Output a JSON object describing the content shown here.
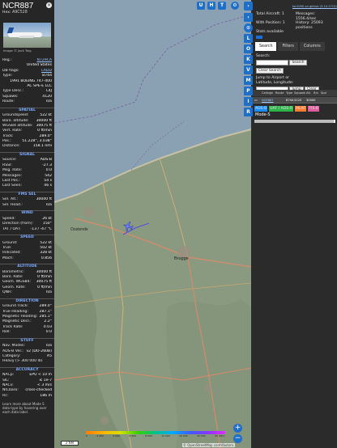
{
  "aircraft": {
    "callsign": "NCR887",
    "hex_label": "Hex:",
    "hex": "A9C528",
    "photo_credit": "Image © Jack Teig",
    "reg_label": "Reg.:",
    "reg": "N729CA",
    "country": "United States",
    "dbflags_label": "DB flags:",
    "dbflags": "LADD",
    "type_label": "Type:",
    "type": "B744",
    "model": "1991 BOEING 747-400",
    "model2": "AC SPE-E LLC",
    "typedesc_label": "Type Desc.:",
    "typedesc": "L4J",
    "squawk_label": "Squawk:",
    "squawk": "4120",
    "route_label": "Route:",
    "route": "n/a"
  },
  "sections": {
    "spatial": "SPATIAL",
    "signal": "SIGNAL",
    "fms": "FMS SEL",
    "wind": "WIND",
    "speed": "SPEED",
    "altitude": "ALTITUDE",
    "direction": "DIRECTION",
    "stuff": "STUFF",
    "accuracy": "ACCURACY"
  },
  "spatial": [
    {
      "k": "Groundspeed:",
      "v": "522 kt"
    },
    {
      "k": "Baro. altitude:",
      "v": "30000 ft"
    },
    {
      "k": "WGS84 altitude:",
      "v": "30075 ft"
    },
    {
      "k": "Vert. Rate:",
      "v": "0 ft/min"
    },
    {
      "k": "Track:",
      "v": "289.0°"
    },
    {
      "k": "Pos.:",
      "v": "51.228°, 3.038°"
    },
    {
      "k": "Distance:",
      "v": "158.1 nmi"
    }
  ],
  "signal": [
    {
      "k": "Source:",
      "v": "ADS-B"
    },
    {
      "k": "RSSI:",
      "v": "-27.3"
    },
    {
      "k": "Msg. Rate:",
      "v": "0.0"
    },
    {
      "k": "Messages:",
      "v": "542"
    },
    {
      "k": "Last Pos.:",
      "v": "54 s"
    },
    {
      "k": "Last Seen:",
      "v": "46 s"
    }
  ],
  "fms": [
    {
      "k": "Sel. Alt.:",
      "v": "30000 ft"
    },
    {
      "k": "Sel. Head.:",
      "v": "n/a"
    }
  ],
  "wind": [
    {
      "k": "Speed:",
      "v": "26 kt"
    },
    {
      "k": "Direction (from):",
      "v": "150°"
    },
    {
      "k": "TAT / OAT:",
      "v": "-13 / -47 °C"
    }
  ],
  "speed": [
    {
      "k": "Ground:",
      "v": "522 kt"
    },
    {
      "k": "True:",
      "v": "502 kt"
    },
    {
      "k": "Indicated:",
      "v": "328 kt"
    },
    {
      "k": "Mach:",
      "v": "0.856"
    }
  ],
  "altitude": [
    {
      "k": "Barometric:",
      "v": "30000 ft"
    },
    {
      "k": "Baro. Rate:",
      "v": "0 ft/min"
    },
    {
      "k": "Geom. WGS84:",
      "v": "30075 ft"
    },
    {
      "k": "Geom. Rate:",
      "v": "0 ft/min"
    },
    {
      "k": "QNH:",
      "v": "n/a"
    }
  ],
  "direction": [
    {
      "k": "Ground Track:",
      "v": "289.0°"
    },
    {
      "k": "True Heading:",
      "v": "287.1°"
    },
    {
      "k": "Magnetic Heading:",
      "v": "285.1°"
    },
    {
      "k": "Magnetic Decl.:",
      "v": "2.2°"
    },
    {
      "k": "Track Rate:",
      "v": "0.03"
    },
    {
      "k": "Roll:",
      "v": "0.0"
    }
  ],
  "stuff": [
    {
      "k": "Nav. Modes:",
      "v": "n/a"
    },
    {
      "k": "ADS-B Ver.:",
      "v": "v2 (DO-260B)"
    },
    {
      "k": "Category:",
      "v": "A5"
    },
    {
      "k": "Heavy (> 300 000 lb)",
      "v": ""
    }
  ],
  "accuracy": [
    {
      "k": "NACp:",
      "v": "EPU < 10 m"
    },
    {
      "k": "SIL:",
      "v": "≤ 1e-7"
    },
    {
      "k": "NACv:",
      "v": "< 3 m/s"
    },
    {
      "k": "NICbaro:",
      "v": "cross-checked"
    },
    {
      "k": "Rc:",
      "v": "186 m"
    }
  ],
  "footer_note": "Learn more about Mode S data type by hovering over each data label.",
  "map": {
    "buttons_top": [
      "U",
      "H",
      "T"
    ],
    "side_buttons": [
      "L",
      "O",
      "K",
      "V",
      "M",
      "P",
      "I",
      "R"
    ],
    "places": [
      "Oostende",
      "Brugge"
    ],
    "scale": "2 NM",
    "attribution": "© OpenStreetMap contributors.",
    "alt_ticks": [
      "0",
      "2 000",
      "4 000",
      "6 000",
      "8 000",
      "10 000",
      "20 000",
      "30 000",
      "40 000+"
    ]
  },
  "right": {
    "link": "tar1090 on github (3.14.1715)",
    "total_label": "Total Aircraft: 1",
    "withpos_label": "With Position: 1",
    "stats_label": "Stats available",
    "messages_label": "Messages:",
    "messages_value": "1556.4/sec",
    "history_label": "History: 25093 positions",
    "tabs": [
      "Search",
      "Filters",
      "Columns"
    ],
    "search_label": "Search:",
    "search_button": "Search",
    "clear_button": "Clear Search",
    "jump_label": "Jump to Airport or Latitude, Longitude:",
    "jump_button": "Jump",
    "jump_clear": "Clear",
    "columns": [
      "",
      "Callsign",
      "Route",
      "Type",
      "Squawk",
      "Alt.",
      "ft/s",
      "Spd"
    ],
    "row": [
      "",
      "NCR887",
      "",
      "B744",
      "4120",
      "30000",
      ""
    ],
    "badges": [
      "ADS-B",
      "UAT / ADS-R",
      "MLAT",
      "TIS-B"
    ],
    "badge_colors": [
      "#1a8cff",
      "#2db34a",
      "#ff7b2e",
      "#e05a9c"
    ],
    "modes": "Mode-S"
  }
}
